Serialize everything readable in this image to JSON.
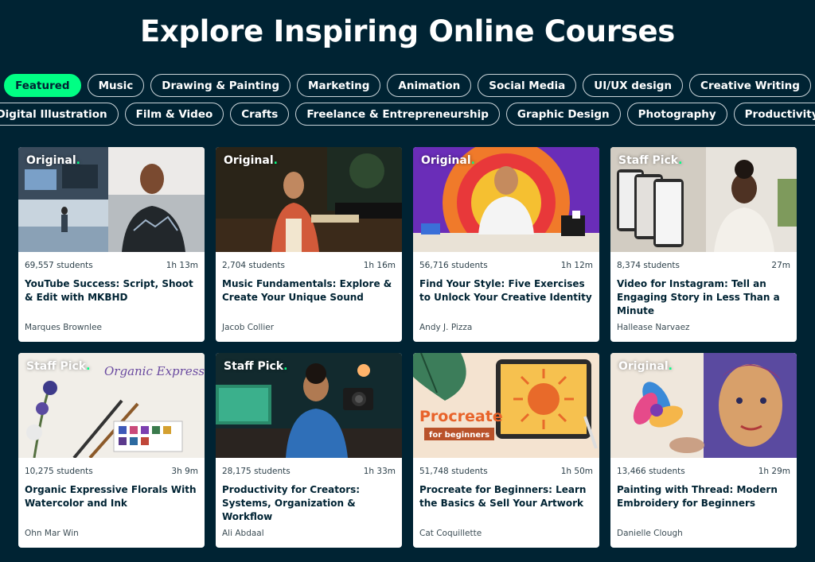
{
  "page_title": "Explore Inspiring Online Courses",
  "categories_row1": [
    {
      "label": "Featured",
      "active": true
    },
    {
      "label": "Music"
    },
    {
      "label": "Drawing & Painting"
    },
    {
      "label": "Marketing"
    },
    {
      "label": "Animation"
    },
    {
      "label": "Social Media"
    },
    {
      "label": "UI/UX design"
    },
    {
      "label": "Creative Writing"
    }
  ],
  "categories_row2": [
    {
      "label": "Digital Illustration"
    },
    {
      "label": "Film & Video"
    },
    {
      "label": "Crafts"
    },
    {
      "label": "Freelance & Entrepreneurship"
    },
    {
      "label": "Graphic Design"
    },
    {
      "label": "Photography"
    },
    {
      "label": "Productivity"
    }
  ],
  "courses": [
    {
      "badge": "Original",
      "students": "69,557 students",
      "duration": "1h 13m",
      "title": "YouTube Success: Script, Shoot & Edit with MKBHD",
      "author": "Marques Brownlee"
    },
    {
      "badge": "Original",
      "students": "2,704 students",
      "duration": "1h 16m",
      "title": "Music Fundamentals: Explore & Create Your Unique Sound",
      "author": "Jacob Collier"
    },
    {
      "badge": "Original",
      "students": "56,716 students",
      "duration": "1h 12m",
      "title": "Find Your Style: Five Exercises to Unlock Your Creative Identity",
      "author": "Andy J. Pizza"
    },
    {
      "badge": "Staff Pick",
      "students": "8,374 students",
      "duration": "27m",
      "title": "Video for Instagram: Tell an Engaging Story in Less Than a Minute",
      "author": "Hallease Narvaez"
    },
    {
      "badge": "Staff Pick",
      "students": "10,275 students",
      "duration": "3h 9m",
      "title": "Organic Expressive Florals With Watercolor and Ink",
      "author": "Ohn Mar Win",
      "thumb_text": "Organic Expressive Florals with Watercolor & Ink"
    },
    {
      "badge": "Staff Pick",
      "students": "28,175 students",
      "duration": "1h 33m",
      "title": "Productivity for Creators: Systems, Organization & Workflow",
      "author": "Ali Abdaal"
    },
    {
      "badge": "",
      "students": "51,748 students",
      "duration": "1h 50m",
      "title": "Procreate for Beginners: Learn the Basics & Sell Your Artwork",
      "author": "Cat Coquillette",
      "thumb_text": "Procreate",
      "thumb_subtext": "for beginners"
    },
    {
      "badge": "Original",
      "students": "13,466 students",
      "duration": "1h 29m",
      "title": "Painting with Thread: Modern Embroidery for Beginners",
      "author": "Danielle Clough"
    }
  ],
  "colors": {
    "background": "#002333",
    "accent": "#00ff84",
    "card": "#ffffff"
  }
}
